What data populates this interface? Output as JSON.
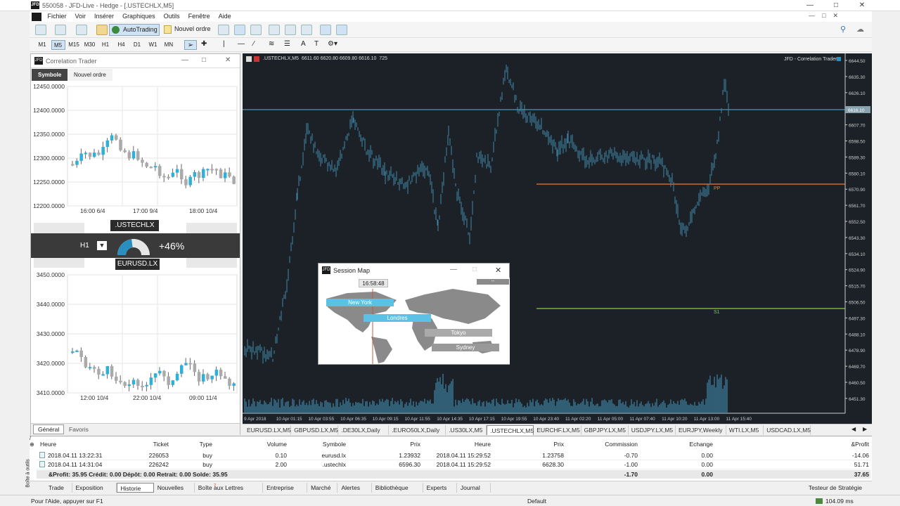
{
  "window": {
    "title": "550058 - JFD-Live - Hedge - [.USTECHLX,M5]",
    "logo": "JFD"
  },
  "menu": [
    "Fichier",
    "Voir",
    "Insérer",
    "Graphiques",
    "Outils",
    "Fenêtre",
    "Aide"
  ],
  "toolbar": {
    "autotrading": "AutoTrading",
    "new_order": "Nouvel ordre"
  },
  "timeframes": [
    "M1",
    "M5",
    "M15",
    "M30",
    "H1",
    "H4",
    "D1",
    "W1",
    "MN"
  ],
  "active_timeframe": "M5",
  "correlation_panel": {
    "title": "Correlation Trader",
    "tabs": [
      "Symbole",
      "Nouvel ordre"
    ],
    "top_chart": {
      "y_ticks": [
        "12450.0000",
        "12400.0000",
        "12350.0000",
        "12300.0000",
        "12250.0000",
        "12200.0000"
      ],
      "x_ticks": [
        "16:00 6/4",
        "17:00 9/4",
        "18:00 10/4"
      ]
    },
    "symbol_top": ".USTECHLX",
    "symbol_bottom": "EURUSD.LX",
    "timeframe": "H1",
    "correlation": "+46%",
    "correlation_value": 46,
    "bottom_chart": {
      "y_ticks": [
        "3450.0000",
        "3440.0000",
        "3430.0000",
        "3420.0000",
        "3410.0000"
      ],
      "x_ticks": [
        "12:00 10/4",
        "22:00 10/4",
        "09:00 11/4"
      ]
    },
    "bottom_tabs": [
      "Général",
      "Favoris"
    ]
  },
  "main_chart": {
    "header": ".USTECHLX,M5  6611.60 6620.80 6609.80 6616.10  725",
    "brand": "JFD - Correlation Trader",
    "current_price": "6616.10",
    "price_ticks": [
      "6644.50",
      "6635.30",
      "6626.10",
      "6616.90",
      "6607.70",
      "6598.50",
      "6589.30",
      "6580.10",
      "6570.90",
      "6561.70",
      "6552.50",
      "6543.30",
      "6534.10",
      "6524.90",
      "6515.70",
      "6506.50",
      "6497.30",
      "6488.10",
      "6478.90",
      "6469.70",
      "6460.50",
      "6451.30"
    ],
    "time_ticks": [
      "9 Apr 2018",
      "10 Apr 01:15",
      "10 Apr 03:55",
      "10 Apr 06:35",
      "10 Apr 09:15",
      "10 Apr 11:55",
      "10 Apr 14:35",
      "10 Apr 17:15",
      "10 Apr 19:55",
      "10 Apr 23:40",
      "11 Apr 02:20",
      "11 Apr 05:00",
      "11 Apr 07:40",
      "11 Apr 10:20",
      "11 Apr 13:00",
      "11 Apr 15:40"
    ],
    "levels": {
      "pp": "PP",
      "s1": "S1"
    },
    "level_colors": {
      "pp": "#f07a3a",
      "s1": "#7fd23a",
      "price": "#5ab4d6"
    }
  },
  "session_map": {
    "title": "Session Map",
    "time": "16:58:48",
    "collapse": "--",
    "sessions": [
      "New York",
      "Londres",
      "Tokyo",
      "Sydney"
    ]
  },
  "symbol_tabs": [
    "EURUSD.LX,M5",
    "GBPUSD.LX,M5",
    ".DE30LX,Daily",
    ".EURO50LX,Daily",
    ".US30LX,M5",
    ".USTECHLX,M5",
    "EURCHF.LX,M5",
    "GBPJPY.LX,M5",
    "USDJPY.LX,M5",
    "EURJPY,Weekly",
    "WTI.LX,M5",
    "USDCAD.LX,M5"
  ],
  "active_symbol_tab": ".USTECHLX,M5",
  "terminal": {
    "side_label": "Boîte à outils",
    "headers": [
      "Heure",
      "Ticket",
      "Type",
      "Volume",
      "Symbole",
      "Prix",
      "Heure",
      "Prix",
      "Commission",
      "Echange",
      "&Profit"
    ],
    "rows": [
      [
        "2018.04.11 13:22:31",
        "226053",
        "buy",
        "0.10",
        "eurusd.lx",
        "1.23932",
        "2018.04.11 15:29:52",
        "1.23758",
        "-0.70",
        "0.00",
        "-14.06"
      ],
      [
        "2018.04.11 14:31:04",
        "226242",
        "buy",
        "2.00",
        ".ustechlx",
        "6596.30",
        "2018.04.11 15:29:52",
        "6628.30",
        "-1.00",
        "0.00",
        "51.71"
      ]
    ],
    "summary": "&Profit: 35.95  Crédit: 0.00  Dépôt: 0.00  Retrait: 0.00  Solde: 35.95",
    "summary_commission": "-1.70",
    "summary_swap": "0.00",
    "summary_profit": "37.65",
    "tabs": [
      "Trade",
      "Exposition",
      "Historie",
      "Nouvelles",
      "Boîte aux Lettres",
      "Entreprise",
      "Marché",
      "Alertes",
      "Bibliothèque",
      "Experts",
      "Journal"
    ],
    "active_tab": "Historie",
    "mail_count": "7",
    "strategy_tester": "Testeur de Stratégie"
  },
  "status": {
    "help": "Pour l'Aide, appuyer sur F1",
    "profile": "Default",
    "ping": "104.09 ms"
  }
}
